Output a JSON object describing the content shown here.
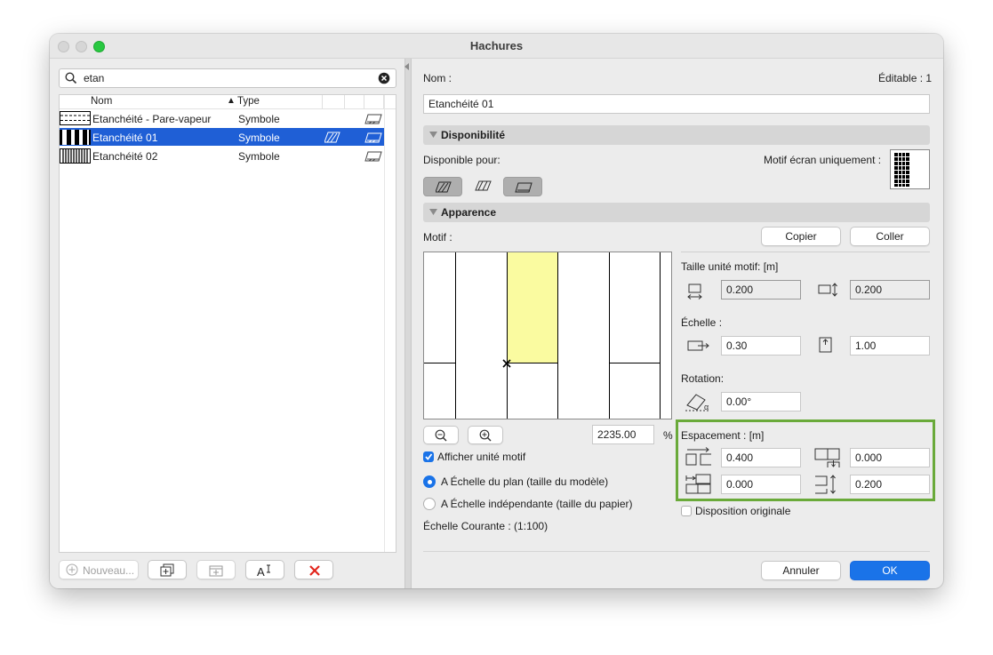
{
  "window": {
    "title": "Hachures"
  },
  "left": {
    "search": {
      "value": "etan"
    },
    "columns": {
      "name": "Nom",
      "type": "Type",
      "sort_indicator": "▲"
    },
    "rows": [
      {
        "name": "Etanchéité - Pare-vapeur",
        "type": "Symbole"
      },
      {
        "name": "Etanchéité 01",
        "type": "Symbole"
      },
      {
        "name": "Etanchéité 02",
        "type": "Symbole"
      }
    ],
    "buttons": {
      "new": "Nouveau..."
    }
  },
  "right": {
    "name_label": "Nom :",
    "editable": "Éditable : 1",
    "name_value": "Etanchéité 01",
    "availability": {
      "header": "Disponibilité",
      "available_for": "Disponible pour:",
      "screen_only": "Motif écran uniquement :"
    },
    "appearance": {
      "header": "Apparence",
      "motif": "Motif :",
      "copy": "Copier",
      "paste": "Coller"
    },
    "unit_size": {
      "label": "Taille unité motif: [m]",
      "width": "0.200",
      "height": "0.200"
    },
    "scale": {
      "label": "Échelle :",
      "x": "0.30",
      "y": "1.00"
    },
    "rotation": {
      "label": "Rotation:",
      "value": "0.00°"
    },
    "spacing": {
      "label": "Espacement : [m]",
      "a": "0.400",
      "b": "0.000",
      "c": "0.000",
      "d": "0.200"
    },
    "original_layout": "Disposition originale",
    "zoom": {
      "value": "2235.00",
      "unit": "%"
    },
    "show_unit": "Afficher unité motif",
    "radio_plan": "A Échelle du plan (taille du modèle)",
    "radio_paper": "A Échelle indépendante (taille du papier)",
    "current_scale": "Échelle Courante : (1:100)",
    "cancel": "Annuler",
    "ok": "OK"
  },
  "colors": {
    "selection": "#1f5fd6",
    "accent": "#1a73e8",
    "highlight_green": "#6aaa3a",
    "preview_yellow": "#fafba0"
  }
}
